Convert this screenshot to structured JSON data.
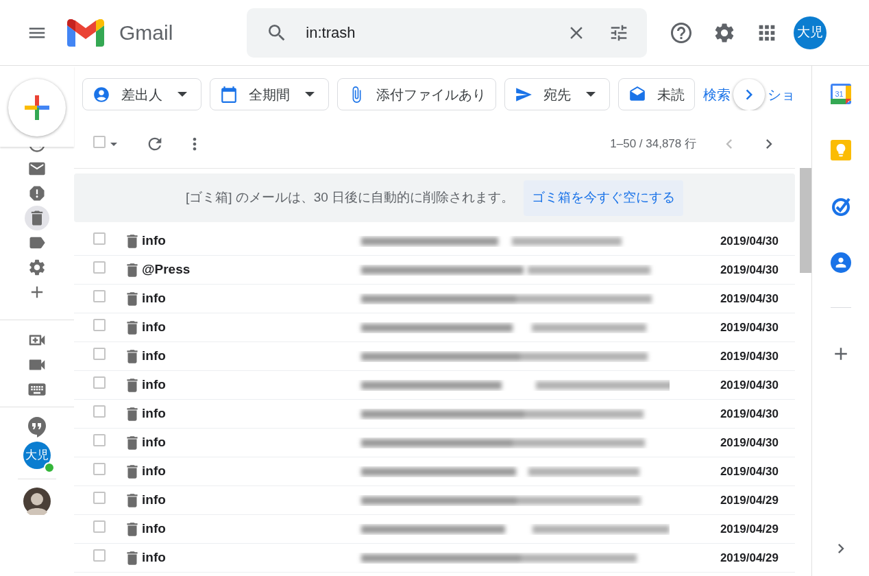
{
  "header": {
    "app_name": "Gmail",
    "search": {
      "value": "in:trash"
    },
    "avatar": "大児"
  },
  "nav_rail": [
    {
      "selected": false
    },
    {
      "selected": false
    },
    {
      "selected": false
    },
    {
      "selected": true
    },
    {
      "selected": false
    },
    {
      "selected": false
    },
    {
      "selected": false
    }
  ],
  "chat": {
    "avatar": "大児",
    "online": true
  },
  "filters": [
    {
      "label": "差出人",
      "has_menu": true
    },
    {
      "label": "全期間",
      "has_menu": true
    },
    {
      "label": "添付ファイルあり",
      "has_menu": false
    },
    {
      "label": "宛先",
      "has_menu": true
    },
    {
      "label": "未読",
      "has_menu": false
    }
  ],
  "search_options_link": {
    "text_before": "検索",
    "text_after": "ショ"
  },
  "toolbar": {
    "select_all_checked": false,
    "range": "1–50 / 34,878 行"
  },
  "banner": {
    "message": "[ゴミ箱] のメールは、30 日後に自動的に削除されます。",
    "action": "ゴミ箱を今すぐ空にする"
  },
  "rows": [
    {
      "sender": "info",
      "date": "2019/04/30",
      "checked": false,
      "unread": true
    },
    {
      "sender": "@Press",
      "date": "2019/04/30",
      "checked": false,
      "unread": true
    },
    {
      "sender": "info",
      "date": "2019/04/30",
      "checked": false,
      "unread": true
    },
    {
      "sender": "info",
      "date": "2019/04/30",
      "checked": false,
      "unread": true
    },
    {
      "sender": "info",
      "date": "2019/04/30",
      "checked": false,
      "unread": true
    },
    {
      "sender": "info",
      "date": "2019/04/30",
      "checked": false,
      "unread": true
    },
    {
      "sender": "info",
      "date": "2019/04/30",
      "checked": false,
      "unread": true
    },
    {
      "sender": "info",
      "date": "2019/04/30",
      "checked": false,
      "unread": true
    },
    {
      "sender": "info",
      "date": "2019/04/30",
      "checked": false,
      "unread": true
    },
    {
      "sender": "info",
      "date": "2019/04/29",
      "checked": false,
      "unread": true
    },
    {
      "sender": "info",
      "date": "2019/04/29",
      "checked": false,
      "unread": true
    },
    {
      "sender": "info",
      "date": "2019/04/29",
      "checked": false,
      "unread": true
    }
  ],
  "side_panel": {
    "calendar_day": "31"
  }
}
